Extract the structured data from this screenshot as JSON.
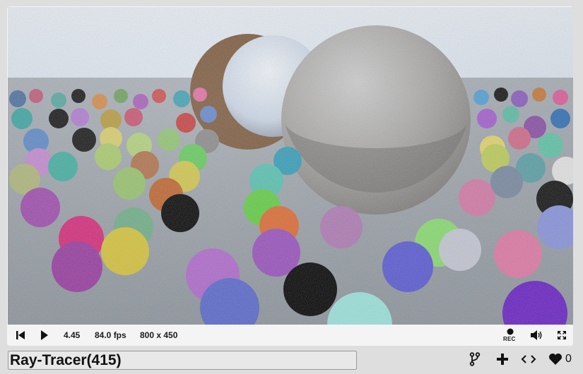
{
  "shader": {
    "title": "Ray-Tracer(415)",
    "likes": "0"
  },
  "player": {
    "time": "4.45",
    "fps": "84.0 fps",
    "resolution": "800 x 450",
    "rec_label": "REC"
  },
  "icons": {
    "rewind": "skip-to-start-icon",
    "play": "play-icon",
    "record": "record-icon",
    "volume": "volume-icon",
    "fullscreen": "fullscreen-icon",
    "fork": "fork-icon",
    "add": "plus-icon",
    "embed": "code-icon",
    "like": "heart-icon"
  },
  "colors": {
    "sky": "#e8eef6",
    "ground": "#9aa3ab",
    "control_bar": "#f4f4f4",
    "text": "#1a1a1a"
  }
}
